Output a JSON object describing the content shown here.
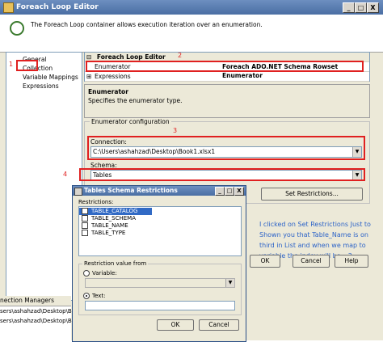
{
  "window": {
    "title": "Foreach Loop Editor",
    "description": "The Foreach Loop container allows execution iteration over an enumeration.",
    "minimize": "_",
    "maximize": "□",
    "close": "X"
  },
  "sidebar": {
    "items": [
      {
        "label": "General"
      },
      {
        "label": "Collection"
      },
      {
        "label": "Variable Mappings"
      },
      {
        "label": "Expressions"
      }
    ]
  },
  "props": {
    "header": "Foreach Loop Editor",
    "enumerator_label": "Enumerator",
    "enumerator_value": "Foreach ADO.NET Schema Rowset Enumerator",
    "expressions_label": "Expressions",
    "expand_minus": "⊟",
    "expand_plus": "⊞"
  },
  "desc_box": {
    "title": "Enumerator",
    "text": "Specifies the enumerator type."
  },
  "enum_config": {
    "legend": "Enumerator configuration",
    "connection_label": "Connection:",
    "connection_value": "C:\\Users\\ashahzad\\Desktop\\Book1.xlsx1",
    "schema_label": "Schema:",
    "schema_value": "Tables",
    "set_restrictions": "Set Restrictions..."
  },
  "annotations": {
    "n1": "1",
    "n2": "2",
    "n3": "3",
    "n4": "4",
    "note": "I clicked on Set Restrictions Just to Shown you that Table_Name is on third in List and when we map to variable the index will be =2"
  },
  "footer": {
    "ok": "OK",
    "cancel": "Cancel",
    "help": "Help"
  },
  "connection_managers": {
    "tab": "nection Managers",
    "rows": [
      "sers\\ashahzad\\Desktop\\Book1.",
      "sers\\ashahzad\\Desktop\\Book1."
    ]
  },
  "dialog": {
    "title": "Tables Schema Restrictions",
    "restrictions_label": "Restrictions:",
    "items": [
      "TABLE_CATALOG",
      "TABLE_SCHEMA",
      "TABLE_NAME",
      "TABLE_TYPE"
    ],
    "value_legend": "Restriction value from",
    "variable_label": "Variable:",
    "text_label": "Text:",
    "ok": "OK",
    "cancel": "Cancel"
  }
}
